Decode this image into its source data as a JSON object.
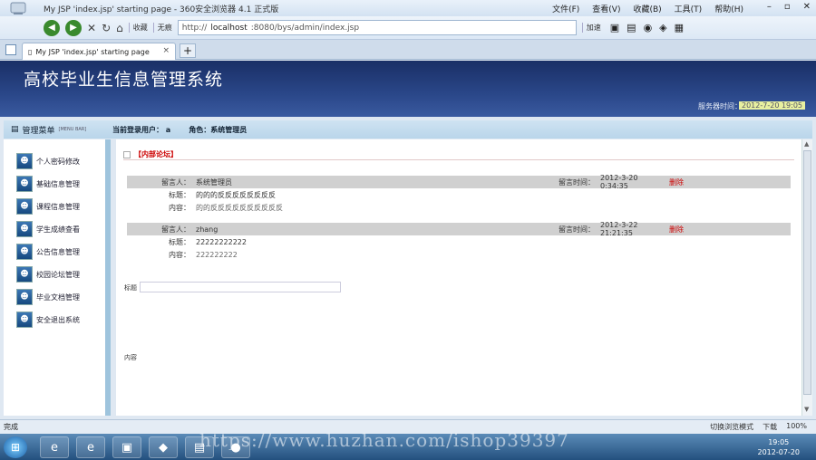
{
  "browser": {
    "window_title": "My JSP 'index.jsp' starting page - 360安全浏览器 4.1 正式版",
    "menus": [
      "文件(F)",
      "查看(V)",
      "收藏(B)",
      "工具(T)",
      "帮助(H)"
    ],
    "back_label": "",
    "tb_favorites": "收藏",
    "tb_noimg": "无痕",
    "address_prefix": "http://",
    "address_host": "localhost",
    "address_rest": ":8080/bys/admin/index.jsp",
    "speedup": "加速",
    "tab_title": "My JSP 'index.jsp' starting page",
    "tab_close": "×",
    "newtab": "+"
  },
  "app": {
    "title": "高校毕业生信息管理系统",
    "server_time_label": "服务器时间：",
    "server_time": "2012-7-20 19:05"
  },
  "status": {
    "menu_title": "管理菜单",
    "menu_title_sub": "[MENU BAR]",
    "current_user_label": "当前登录用户：",
    "current_user": "a",
    "role_label": "角色：",
    "role": "系统管理员"
  },
  "sidebar": {
    "items": [
      {
        "label": "个人密码修改"
      },
      {
        "label": "基础信息管理"
      },
      {
        "label": "课程信息管理"
      },
      {
        "label": "学生成绩查看"
      },
      {
        "label": "公告信息管理"
      },
      {
        "label": "校园论坛管理"
      },
      {
        "label": "毕业文档管理"
      },
      {
        "label": "安全退出系统"
      }
    ]
  },
  "main": {
    "section_title": "【内部论坛】",
    "messages": [
      {
        "author_label": "留言人：",
        "author": "系统管理员",
        "time_label": "留言时间：",
        "time": "2012-3-20 0:34:35",
        "delete": "删除",
        "subject_label": "标题：",
        "subject": "的的的反反反反反反反反",
        "content_label": "内容：",
        "content": "的的反反反反反反反反反反"
      },
      {
        "author_label": "留言人：",
        "author": "zhang",
        "time_label": "留言时间：",
        "time": "2012-3-22 21:21:35",
        "delete": "删除",
        "subject_label": "标题：",
        "subject": "22222222222",
        "content_label": "内容：",
        "content": "222222222"
      }
    ],
    "form_subject_label": "标题",
    "form_content_label": "内容"
  },
  "statusbar": {
    "left": "完成",
    "right": [
      "切换浏览模式",
      "下载",
      "100%"
    ]
  },
  "taskbar": {
    "clock_time": "19:05",
    "clock_date": "2012-07-20"
  },
  "watermark": "https://www.huzhan.com/ishop39397"
}
